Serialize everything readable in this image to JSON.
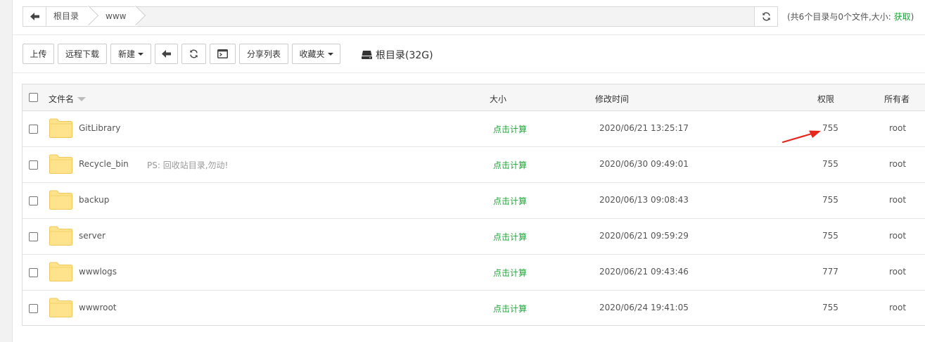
{
  "pathbar": {
    "crumbs": [
      "根目录",
      "www"
    ]
  },
  "summary": {
    "text": "(共6个目录与0个文件,大小: ",
    "link": "获取",
    "close": ")"
  },
  "toolbar": {
    "upload": "上传",
    "remote_download": "远程下载",
    "new": "新建",
    "share_list": "分享列表",
    "favorites": "收藏夹",
    "disk": "根目录(32G)"
  },
  "table": {
    "headers": {
      "name": "文件名",
      "size": "大小",
      "mtime": "修改时间",
      "perm": "权限",
      "owner": "所有者"
    },
    "rows": [
      {
        "name": "GitLibrary",
        "note": "",
        "size": "点击计算",
        "mtime": "2020/06/21 13:25:17",
        "perm": "755",
        "owner": "root"
      },
      {
        "name": "Recycle_bin",
        "note": "PS: 回收站目录,勿动!",
        "size": "点击计算",
        "mtime": "2020/06/30 09:49:01",
        "perm": "755",
        "owner": "root"
      },
      {
        "name": "backup",
        "note": "",
        "size": "点击计算",
        "mtime": "2020/06/13 09:08:43",
        "perm": "755",
        "owner": "root"
      },
      {
        "name": "server",
        "note": "",
        "size": "点击计算",
        "mtime": "2020/06/21 09:59:29",
        "perm": "755",
        "owner": "root"
      },
      {
        "name": "wwwlogs",
        "note": "",
        "size": "点击计算",
        "mtime": "2020/06/21 09:43:46",
        "perm": "777",
        "owner": "root"
      },
      {
        "name": "wwwroot",
        "note": "",
        "size": "点击计算",
        "mtime": "2020/06/24 19:41:05",
        "perm": "755",
        "owner": "root"
      }
    ]
  },
  "colors": {
    "accent_green": "#20a53a",
    "folder_fill": "#ffe38c",
    "annotation_red": "#e8271c"
  },
  "icons": {
    "back": "arrow-left-icon",
    "refresh": "refresh-icon",
    "terminal": "terminal-icon",
    "disk": "hard-drive-icon",
    "folder": "folder-icon"
  }
}
